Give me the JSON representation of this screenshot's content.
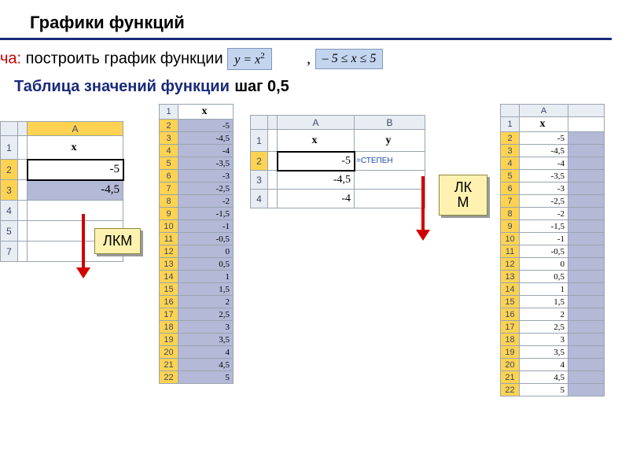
{
  "title": "Графики функций",
  "task_prefix": "ча:",
  "task_text": " построить график функции ",
  "formula1_html": "y = x<sup>2</sup>",
  "formula2_html": "– 5 ≤ x ≤ 5",
  "subhead": "Таблица значений функции",
  "step": "шаг 0,5",
  "lkm": "ЛКМ",
  "lkm2_line1": "ЛК",
  "lkm2_line2": "М",
  "panel1": {
    "colA": "A",
    "rows": [
      "1",
      "2",
      "3",
      "4",
      "5",
      "7"
    ],
    "header_x": "x",
    "v2": "-5",
    "v3": "-4,5"
  },
  "panel2": {
    "header_x": "x",
    "data": [
      {
        "r": "2",
        "v": "-5"
      },
      {
        "r": "3",
        "v": "-4,5"
      },
      {
        "r": "4",
        "v": "-4"
      },
      {
        "r": "5",
        "v": "-3,5"
      },
      {
        "r": "6",
        "v": "-3"
      },
      {
        "r": "7",
        "v": "-2,5"
      },
      {
        "r": "8",
        "v": "-2"
      },
      {
        "r": "9",
        "v": "-1,5"
      },
      {
        "r": "10",
        "v": "-1"
      },
      {
        "r": "11",
        "v": "-0,5"
      },
      {
        "r": "12",
        "v": "0"
      },
      {
        "r": "13",
        "v": "0,5"
      },
      {
        "r": "14",
        "v": "1"
      },
      {
        "r": "15",
        "v": "1,5"
      },
      {
        "r": "16",
        "v": "2"
      },
      {
        "r": "17",
        "v": "2,5"
      },
      {
        "r": "18",
        "v": "3"
      },
      {
        "r": "19",
        "v": "3,5"
      },
      {
        "r": "20",
        "v": "4"
      },
      {
        "r": "21",
        "v": "4,5"
      },
      {
        "r": "22",
        "v": "5"
      }
    ]
  },
  "panel3": {
    "colA": "A",
    "colB": "B",
    "header_x": "x",
    "header_y": "y",
    "rows": [
      {
        "r": "2",
        "a": "-5",
        "b": "=СТЕПЕН"
      },
      {
        "r": "3",
        "a": "-4,5",
        "b": ""
      },
      {
        "r": "4",
        "a": "-4",
        "b": ""
      }
    ]
  },
  "panel4": {
    "colA": "A",
    "header_x": "x",
    "data": [
      {
        "r": "2",
        "v": "-5"
      },
      {
        "r": "3",
        "v": "-4,5"
      },
      {
        "r": "4",
        "v": "-4"
      },
      {
        "r": "5",
        "v": "-3,5"
      },
      {
        "r": "6",
        "v": "-3"
      },
      {
        "r": "7",
        "v": "-2,5"
      },
      {
        "r": "8",
        "v": "-2"
      },
      {
        "r": "9",
        "v": "-1,5"
      },
      {
        "r": "10",
        "v": "-1"
      },
      {
        "r": "11",
        "v": "-0,5"
      },
      {
        "r": "12",
        "v": "0"
      },
      {
        "r": "13",
        "v": "0,5"
      },
      {
        "r": "14",
        "v": "1"
      },
      {
        "r": "15",
        "v": "1,5"
      },
      {
        "r": "16",
        "v": "2"
      },
      {
        "r": "17",
        "v": "2,5"
      },
      {
        "r": "18",
        "v": "3"
      },
      {
        "r": "19",
        "v": "3,5"
      },
      {
        "r": "20",
        "v": "4"
      },
      {
        "r": "21",
        "v": "4,5"
      },
      {
        "r": "22",
        "v": "5"
      }
    ]
  }
}
